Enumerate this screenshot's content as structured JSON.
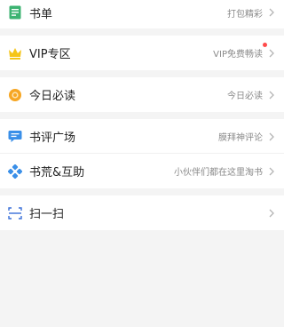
{
  "menu": {
    "booklist": {
      "label": "书单",
      "sub": "打包精彩",
      "icon": "booklist-icon",
      "color": "#3cb371"
    },
    "vip": {
      "label": "VIP专区",
      "sub": "VIP免费畅读",
      "icon": "crown-icon",
      "color": "#f5c518",
      "badge_color": "#ff4b4b"
    },
    "daily": {
      "label": "今日必读",
      "sub": "今日必读",
      "icon": "daily-read-icon",
      "color": "#f6a623"
    },
    "review": {
      "label": "书评广场",
      "sub": "膜拜神评论",
      "icon": "comment-bubble-icon",
      "color": "#3a8fe8"
    },
    "help": {
      "label": "书荒&互助",
      "sub": "小伙伴们都在这里淘书",
      "icon": "puzzle-icon",
      "color": "#3a8fe8"
    },
    "scan": {
      "label": "扫一扫",
      "icon": "scan-icon",
      "color": "#3a6fd8"
    }
  }
}
